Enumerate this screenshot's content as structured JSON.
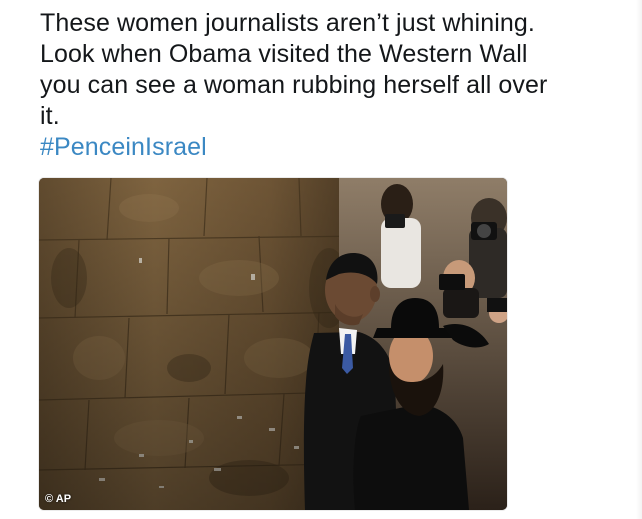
{
  "tweet": {
    "text_lines": [
      "These women journalists aren’t just whining.",
      "Look when Obama visited the Western Wall",
      "you can see a woman rubbing herself all over",
      "it."
    ],
    "hashtag": "#PenceinIsrael",
    "hashtag_color": "#3b88c3"
  },
  "media": {
    "subject": "photograph-western-wall-visit",
    "credit": "© AP"
  }
}
